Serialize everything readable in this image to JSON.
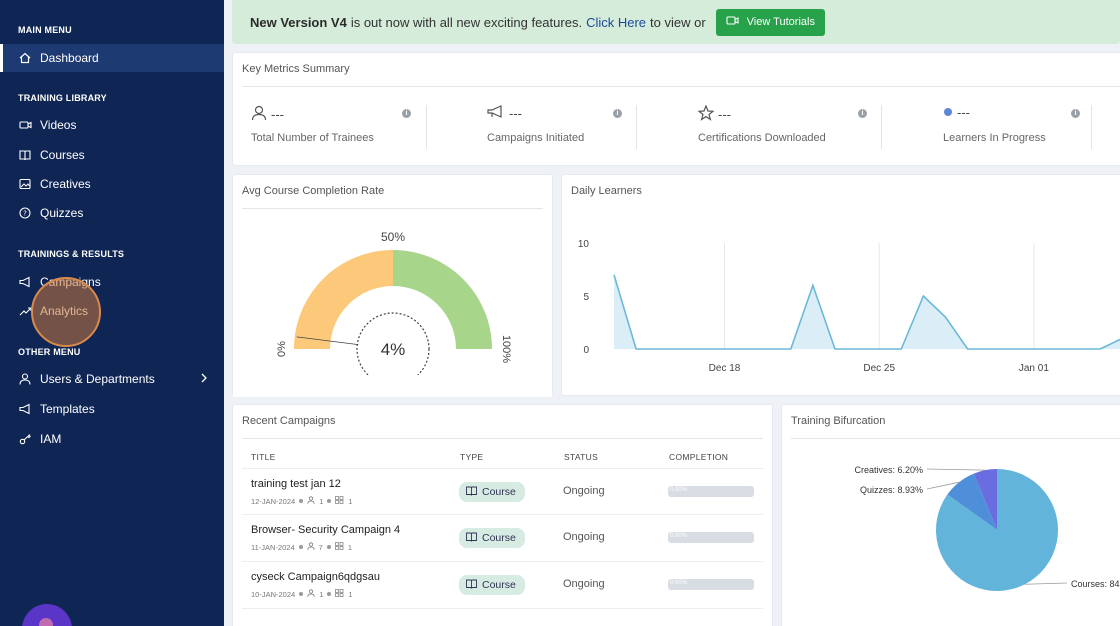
{
  "sidebar": {
    "sections": {
      "main": "MAIN MENU",
      "library": "TRAINING LIBRARY",
      "results": "TRAININGS & RESULTS",
      "other": "OTHER MENU"
    },
    "items": {
      "dashboard": "Dashboard",
      "videos": "Videos",
      "courses": "Courses",
      "creatives": "Creatives",
      "quizzes": "Quizzes",
      "campaigns": "Campaigns",
      "analytics": "Analytics",
      "users": "Users & Departments",
      "templates": "Templates",
      "iam": "IAM"
    }
  },
  "banner": {
    "version": "New Version V4",
    "text": "is out now with all new exciting features.",
    "link": "Click Here",
    "suffix": "to view or",
    "button": "View Tutorials"
  },
  "metrics": {
    "title": "Key Metrics Summary",
    "items": [
      {
        "value": "---",
        "label": "Total Number of Trainees",
        "icon": "user-icon"
      },
      {
        "value": "---",
        "label": "Campaigns Initiated",
        "icon": "megaphone-icon"
      },
      {
        "value": "---",
        "label": "Certifications Downloaded",
        "icon": "star-icon"
      },
      {
        "value": "---",
        "label": "Learners In Progress",
        "icon": "dot-icon"
      }
    ]
  },
  "completion": {
    "title": "Avg Course Completion Rate",
    "value": "4%",
    "fraction": 0.04,
    "label_min": "0%",
    "label_mid": "50%",
    "label_max": "100%",
    "colors": {
      "low": "#fcc97a",
      "high": "#a7d58a"
    }
  },
  "daily": {
    "title": "Daily Learners",
    "color": "#6ab8d9"
  },
  "chart_data": {
    "type": "area",
    "x": [
      "Dec 13",
      "Dec 14",
      "Dec 15",
      "Dec 16",
      "Dec 17",
      "Dec 18",
      "Dec 19",
      "Dec 20",
      "Dec 21",
      "Dec 22",
      "Dec 23",
      "Dec 24",
      "Dec 25",
      "Dec 26",
      "Dec 27",
      "Dec 28",
      "Dec 29",
      "Dec 30",
      "Dec 31",
      "Jan 01",
      "Jan 02",
      "Jan 03",
      "Jan 04",
      "Jan 05"
    ],
    "y": [
      7,
      0,
      0,
      0,
      0,
      0,
      0,
      0,
      0,
      6,
      0,
      0,
      0,
      0,
      5,
      3,
      0,
      0,
      0,
      0,
      0,
      0,
      0,
      1
    ],
    "xticks": [
      "Dec 18",
      "Dec 25",
      "Jan 01"
    ],
    "yticks": [
      "0",
      "5",
      "10"
    ],
    "ylim": [
      0,
      10
    ],
    "grid": true
  },
  "recent": {
    "title": "Recent Campaigns",
    "headers": [
      "TITLE",
      "TYPE",
      "STATUS",
      "COMPLETION"
    ],
    "rows": [
      {
        "title": "training test jan 12",
        "date": "12-JAN-2024",
        "users": "1",
        "groups": "1",
        "type": "Course",
        "status": "Ongoing",
        "progress": "0.00%"
      },
      {
        "title": "Browser- Security Campaign 4",
        "date": "11-JAN-2024",
        "users": "7",
        "groups": "1",
        "type": "Course",
        "status": "Ongoing",
        "progress": "0.00%"
      },
      {
        "title": "cyseck Campaign6qdgsau",
        "date": "10-JAN-2024",
        "users": "1",
        "groups": "1",
        "type": "Course",
        "status": "Ongoing",
        "progress": "0.00%"
      }
    ]
  },
  "bifurcation": {
    "title": "Training Bifurcation",
    "slices": [
      {
        "label": "Courses: 84",
        "value": 84.87,
        "color": "#63b4db"
      },
      {
        "label": "Quizzes: 8.93%",
        "value": 8.93,
        "color": "#4f8fd9"
      },
      {
        "label": "Creatives: 6.20%",
        "value": 6.2,
        "color": "#6a6de0"
      }
    ]
  }
}
